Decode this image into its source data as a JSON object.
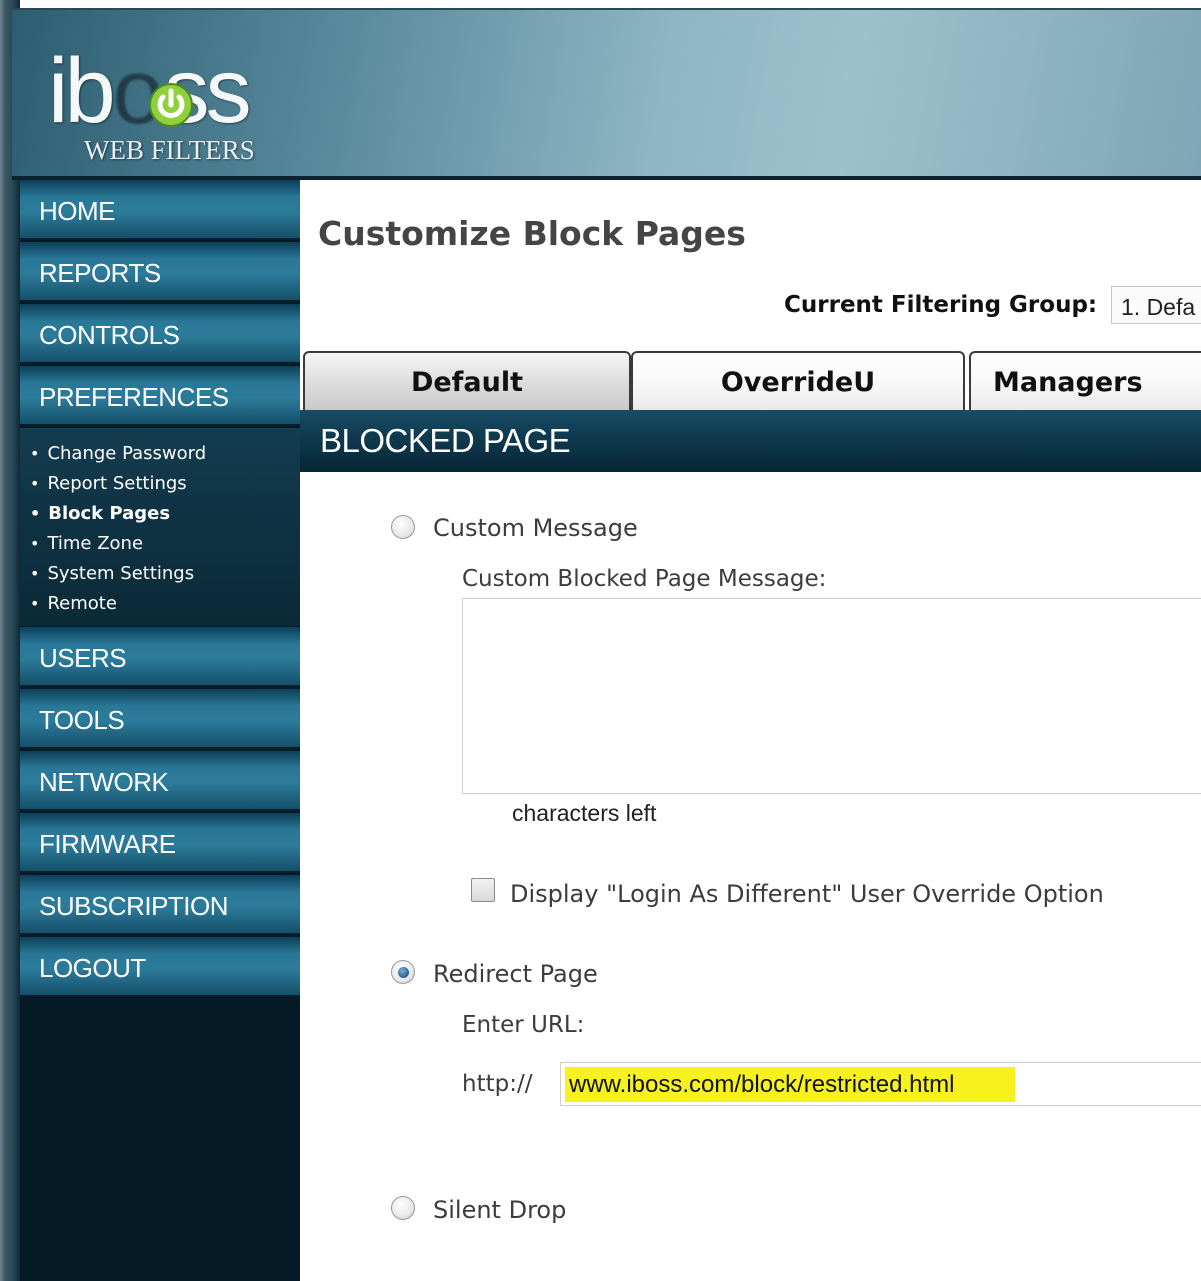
{
  "brand": {
    "logo_text_left": "ib",
    "logo_text_right": "ss",
    "subtitle": "WEB FILTERS",
    "accent_color": "#7ec431"
  },
  "sidebar": {
    "items_top": [
      {
        "label": "HOME"
      },
      {
        "label": "REPORTS"
      },
      {
        "label": "CONTROLS"
      },
      {
        "label": "PREFERENCES"
      }
    ],
    "subitems": [
      {
        "label": "Change Password",
        "active": false
      },
      {
        "label": "Report Settings",
        "active": false
      },
      {
        "label": "Block Pages",
        "active": true
      },
      {
        "label": "Time Zone",
        "active": false
      },
      {
        "label": "System Settings",
        "active": false
      },
      {
        "label": "Remote",
        "active": false
      }
    ],
    "items_bottom": [
      {
        "label": "USERS"
      },
      {
        "label": "TOOLS"
      },
      {
        "label": "NETWORK"
      },
      {
        "label": "FIRMWARE"
      },
      {
        "label": "SUBSCRIPTION"
      },
      {
        "label": "LOGOUT"
      }
    ]
  },
  "main": {
    "title": "Customize Block Pages",
    "filtering_group_label": "Current Filtering Group:",
    "filtering_group_value": "1. Defa",
    "tabs": [
      {
        "label": "Default",
        "selected": true
      },
      {
        "label": "OverrideU",
        "selected": false
      },
      {
        "label": "Managers",
        "selected": false
      }
    ],
    "section_title": "BLOCKED PAGE",
    "custom_message": {
      "label": "Custom Message",
      "selected": false,
      "field_label": "Custom Blocked Page Message:",
      "value": "",
      "chars_left": "characters left"
    },
    "login_override": {
      "label": "Display \"Login As Different\" User Override Option",
      "checked": false
    },
    "redirect": {
      "label": "Redirect Page",
      "selected": true,
      "field_label": "Enter URL:",
      "prefix": "http://",
      "url": "www.iboss.com/block/restricted.html",
      "highlight_color": "#f7f21d"
    },
    "silent_drop": {
      "label": "Silent Drop",
      "selected": false
    }
  }
}
